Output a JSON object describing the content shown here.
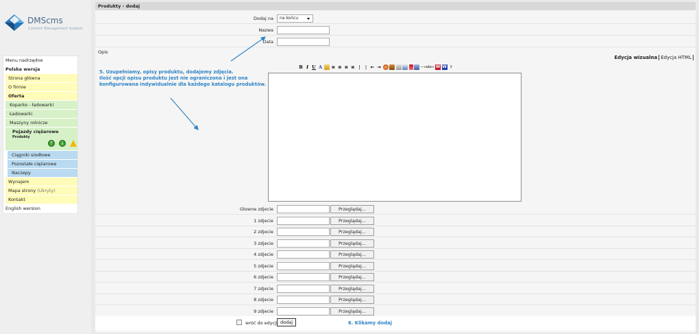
{
  "logo": {
    "brand": "DMScms",
    "tagline": "Content Management System"
  },
  "sidebar": {
    "items": [
      {
        "label": "Menu nadrzędne"
      },
      {
        "label": "Polska wersja"
      },
      {
        "label": "Strona główna"
      },
      {
        "label": "O firmie"
      },
      {
        "label": "Oferta"
      },
      {
        "label": "Koparko - ładowarki"
      },
      {
        "label": "Ładowarki"
      },
      {
        "label": "Maszyny rolnicze"
      },
      {
        "label": "Pojazdy ciężarowe",
        "sub": "Produkty"
      },
      {
        "label": "Ciągniki siodłowe"
      },
      {
        "label": "Pozostałe ciężarowe"
      },
      {
        "label": "Naczepy"
      },
      {
        "label": "Wynajem"
      },
      {
        "label": "Mapa strony",
        "note": "(Ukryty)"
      },
      {
        "label": "Kontakt"
      },
      {
        "label": "English wersion"
      }
    ]
  },
  "main": {
    "title": "Produkty - dodaj",
    "dodaj_na_label": "Dodaj na",
    "dodaj_na_value": "na końcu",
    "nazwa_label": "Nazwa",
    "data_label": "Data",
    "opis_label": "Opis",
    "tabs": [
      {
        "label": "Edycja wizualna"
      },
      {
        "label": "Edycja HTML"
      }
    ],
    "toolbar": {
      "bold": "B",
      "italic": "I",
      "underline": "U",
      "font_color": "A",
      "text_tool": "—»abc»",
      "word1": "W",
      "word2": "W",
      "help": "?"
    },
    "image_rows": [
      {
        "label": "Glowne zdjecie"
      },
      {
        "label": "1 zdjecie"
      },
      {
        "label": "2 zdjecie"
      },
      {
        "label": "3 zdjecie"
      },
      {
        "label": "4 zdjecie"
      },
      {
        "label": "5 zdjecie"
      },
      {
        "label": "6 zdjecie"
      },
      {
        "label": "7 zdjecie"
      },
      {
        "label": "8 zdjecie"
      },
      {
        "label": "9 zdjecie"
      }
    ],
    "browse_label": "Przeglądaj...",
    "return_label": "wróć do edycji",
    "add_label": "dodaj"
  },
  "annotations": {
    "note5_l1": "5. Uzupełniamy, opisy produktu, dodajemy zdjęcia.",
    "note5_l2": "Ilość opcji opisu produktu jest nie ograniczona i jest ona",
    "note5_l3": "konfigurowana indywidualnie dla każdego katalogu produktów.",
    "note6": "6. Klikamy dodaj",
    "color": "#2f84c6"
  }
}
